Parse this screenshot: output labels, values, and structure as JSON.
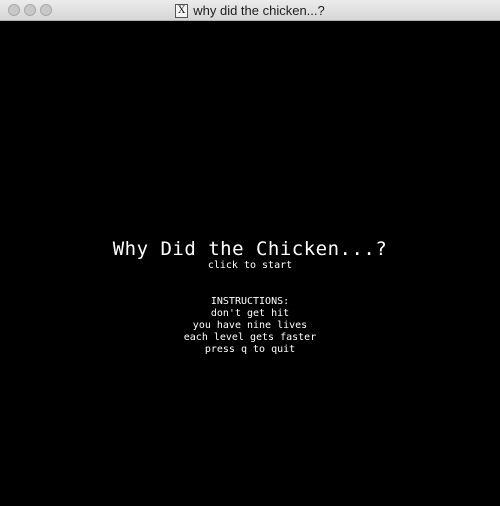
{
  "window": {
    "title": "why did the chicken...?",
    "icon": "x11-icon",
    "icon_glyph": "X"
  },
  "game": {
    "title": "Why Did the Chicken...?",
    "start_hint": "click to start"
  },
  "instructions": {
    "heading": "INSTRUCTIONS:",
    "lines": [
      "don't get hit",
      "you have nine lives",
      "each level gets faster",
      "press q to quit"
    ]
  },
  "colors": {
    "background": "#000000",
    "text": "#ffffff",
    "titlebar": "#e0e0e0"
  }
}
